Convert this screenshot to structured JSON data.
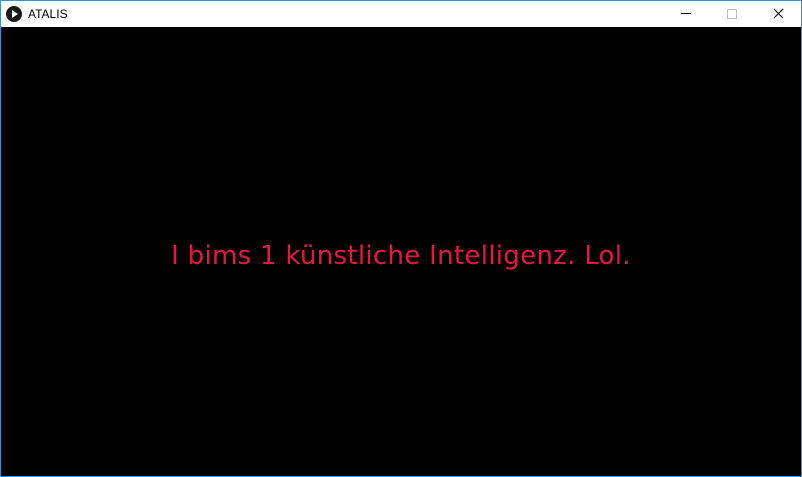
{
  "window": {
    "title": "ATALIS",
    "icon": "play-circle-icon",
    "controls": {
      "minimize_icon": "minimize-icon",
      "maximize_icon": "maximize-icon",
      "close_icon": "close-icon"
    }
  },
  "canvas": {
    "message": "I bims 1 künstliche Intelligenz. Lol."
  },
  "colors": {
    "canvas_background": "#000000",
    "message_text": "#e8163f",
    "window_border": "#3a8fd6"
  }
}
